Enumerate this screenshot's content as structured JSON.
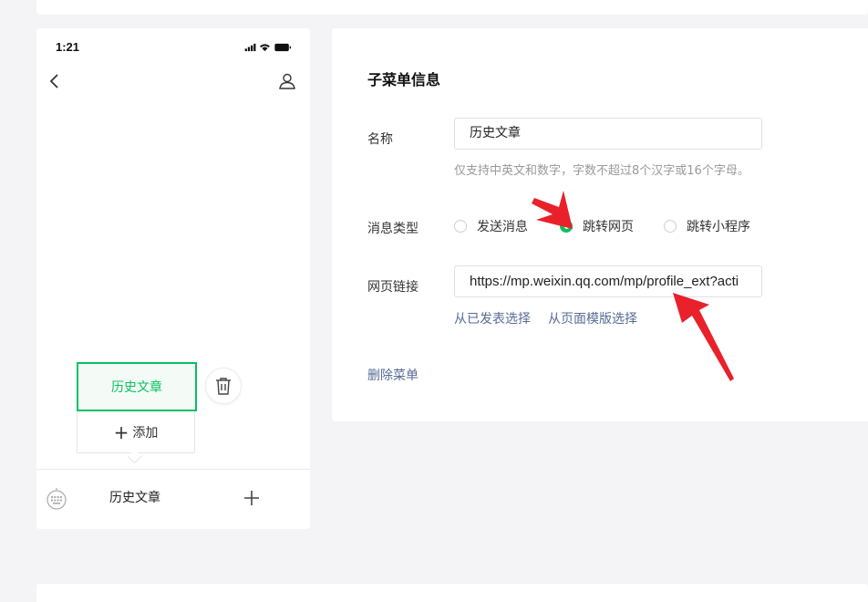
{
  "phone": {
    "status_time": "1:21",
    "submenu": {
      "active_label": "历史文章",
      "add_label": "添加"
    },
    "menu_bar": {
      "item_label": "历史文章"
    }
  },
  "form": {
    "title": "子菜单信息",
    "name": {
      "label": "名称",
      "value": "历史文章",
      "hint": "仅支持中英文和数字，字数不超过8个汉字或16个字母。"
    },
    "message_type": {
      "label": "消息类型",
      "options": [
        "发送消息",
        "跳转网页",
        "跳转小程序"
      ],
      "selected": "跳转网页"
    },
    "url": {
      "label": "网页链接",
      "value": "https://mp.weixin.qq.com/mp/profile_ext?acti"
    },
    "links": {
      "from_published": "从已发表选择",
      "from_template": "从页面模版选择"
    },
    "delete_label": "删除菜单"
  },
  "colors": {
    "accent": "#07c160",
    "link": "#576b95",
    "annotation_arrow": "#e8212b"
  }
}
